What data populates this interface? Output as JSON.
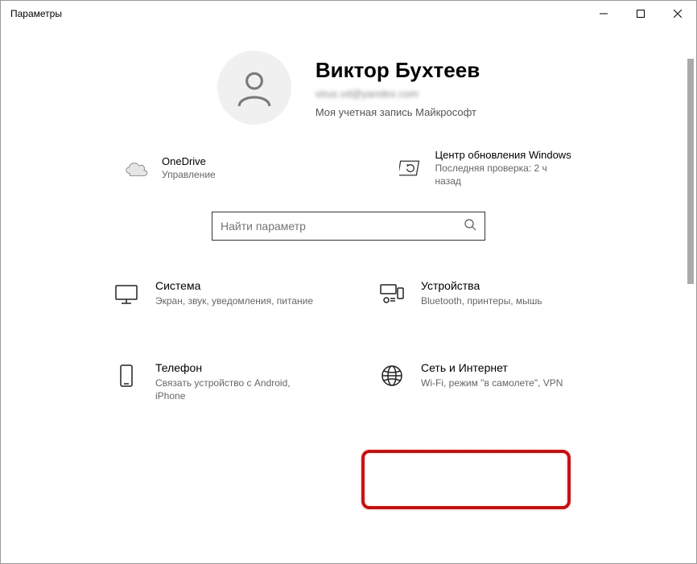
{
  "window": {
    "title": "Параметры"
  },
  "user": {
    "name": "Виктор Бухтеев",
    "email": "virus.vd@yandex.com",
    "account_label": "Моя учетная запись Майкрософт"
  },
  "tiles": {
    "onedrive": {
      "title": "OneDrive",
      "sub": "Управление"
    },
    "update": {
      "title": "Центр обновления Windows",
      "sub": "Последняя проверка: 2 ч назад"
    }
  },
  "search": {
    "placeholder": "Найти параметр"
  },
  "categories": {
    "system": {
      "title": "Система",
      "sub": "Экран, звук, уведомления, питание"
    },
    "devices": {
      "title": "Устройства",
      "sub": "Bluetooth, принтеры, мышь"
    },
    "phone": {
      "title": "Телефон",
      "sub": "Связать устройство с Android, iPhone"
    },
    "network": {
      "title": "Сеть и Интернет",
      "sub": "Wi-Fi, режим \"в самолете\", VPN"
    }
  }
}
